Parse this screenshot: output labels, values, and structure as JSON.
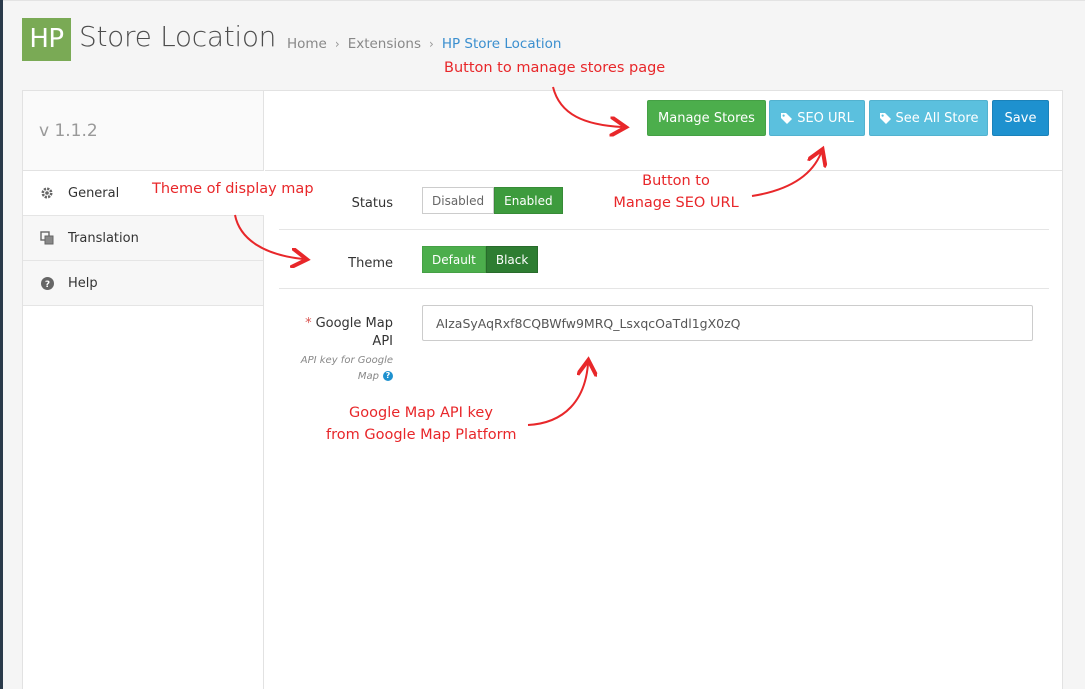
{
  "header": {
    "logo": "HP",
    "title": "Store Location",
    "breadcrumb": [
      "Home",
      "Extensions",
      "HP Store Location"
    ]
  },
  "sidebar": {
    "version": "v 1.1.2",
    "items": [
      {
        "label": "General",
        "icon": "gear-icon",
        "active": true
      },
      {
        "label": "Translation",
        "icon": "translate-icon",
        "active": false
      },
      {
        "label": "Help",
        "icon": "question-circle-icon",
        "active": false
      }
    ]
  },
  "toolbar": {
    "manage_stores": "Manage Stores",
    "seo_url": "SEO URL",
    "see_all_store": "See All Store",
    "save": "Save"
  },
  "form": {
    "status": {
      "label": "Status",
      "off": "Disabled",
      "on": "Enabled",
      "value": "Enabled"
    },
    "theme": {
      "label": "Theme",
      "option_a": "Default",
      "option_b": "Black",
      "value": "Black"
    },
    "api_key": {
      "required_mark": "*",
      "label_line1": "Google Map",
      "label_line2": "API",
      "help_line1": "API key for Google",
      "help_line2": "Map",
      "help_icon": "?",
      "value": "AIzaSyAqRxf8CQBWfw9MRQ_LsxqcOaTdl1gX0zQ"
    }
  },
  "annotations": {
    "manage_stores": "Button to manage stores page",
    "seo_line1": "Button to",
    "seo_line2": "Manage SEO URL",
    "theme": "Theme of display map",
    "api_line1": "Google Map API key",
    "api_line2": "from Google Map Platform"
  },
  "colors": {
    "annotation": "#e8272a",
    "success": "#4cae4c",
    "info": "#5bc0de",
    "primary": "#1e91cf",
    "logo": "#7aaa55"
  }
}
